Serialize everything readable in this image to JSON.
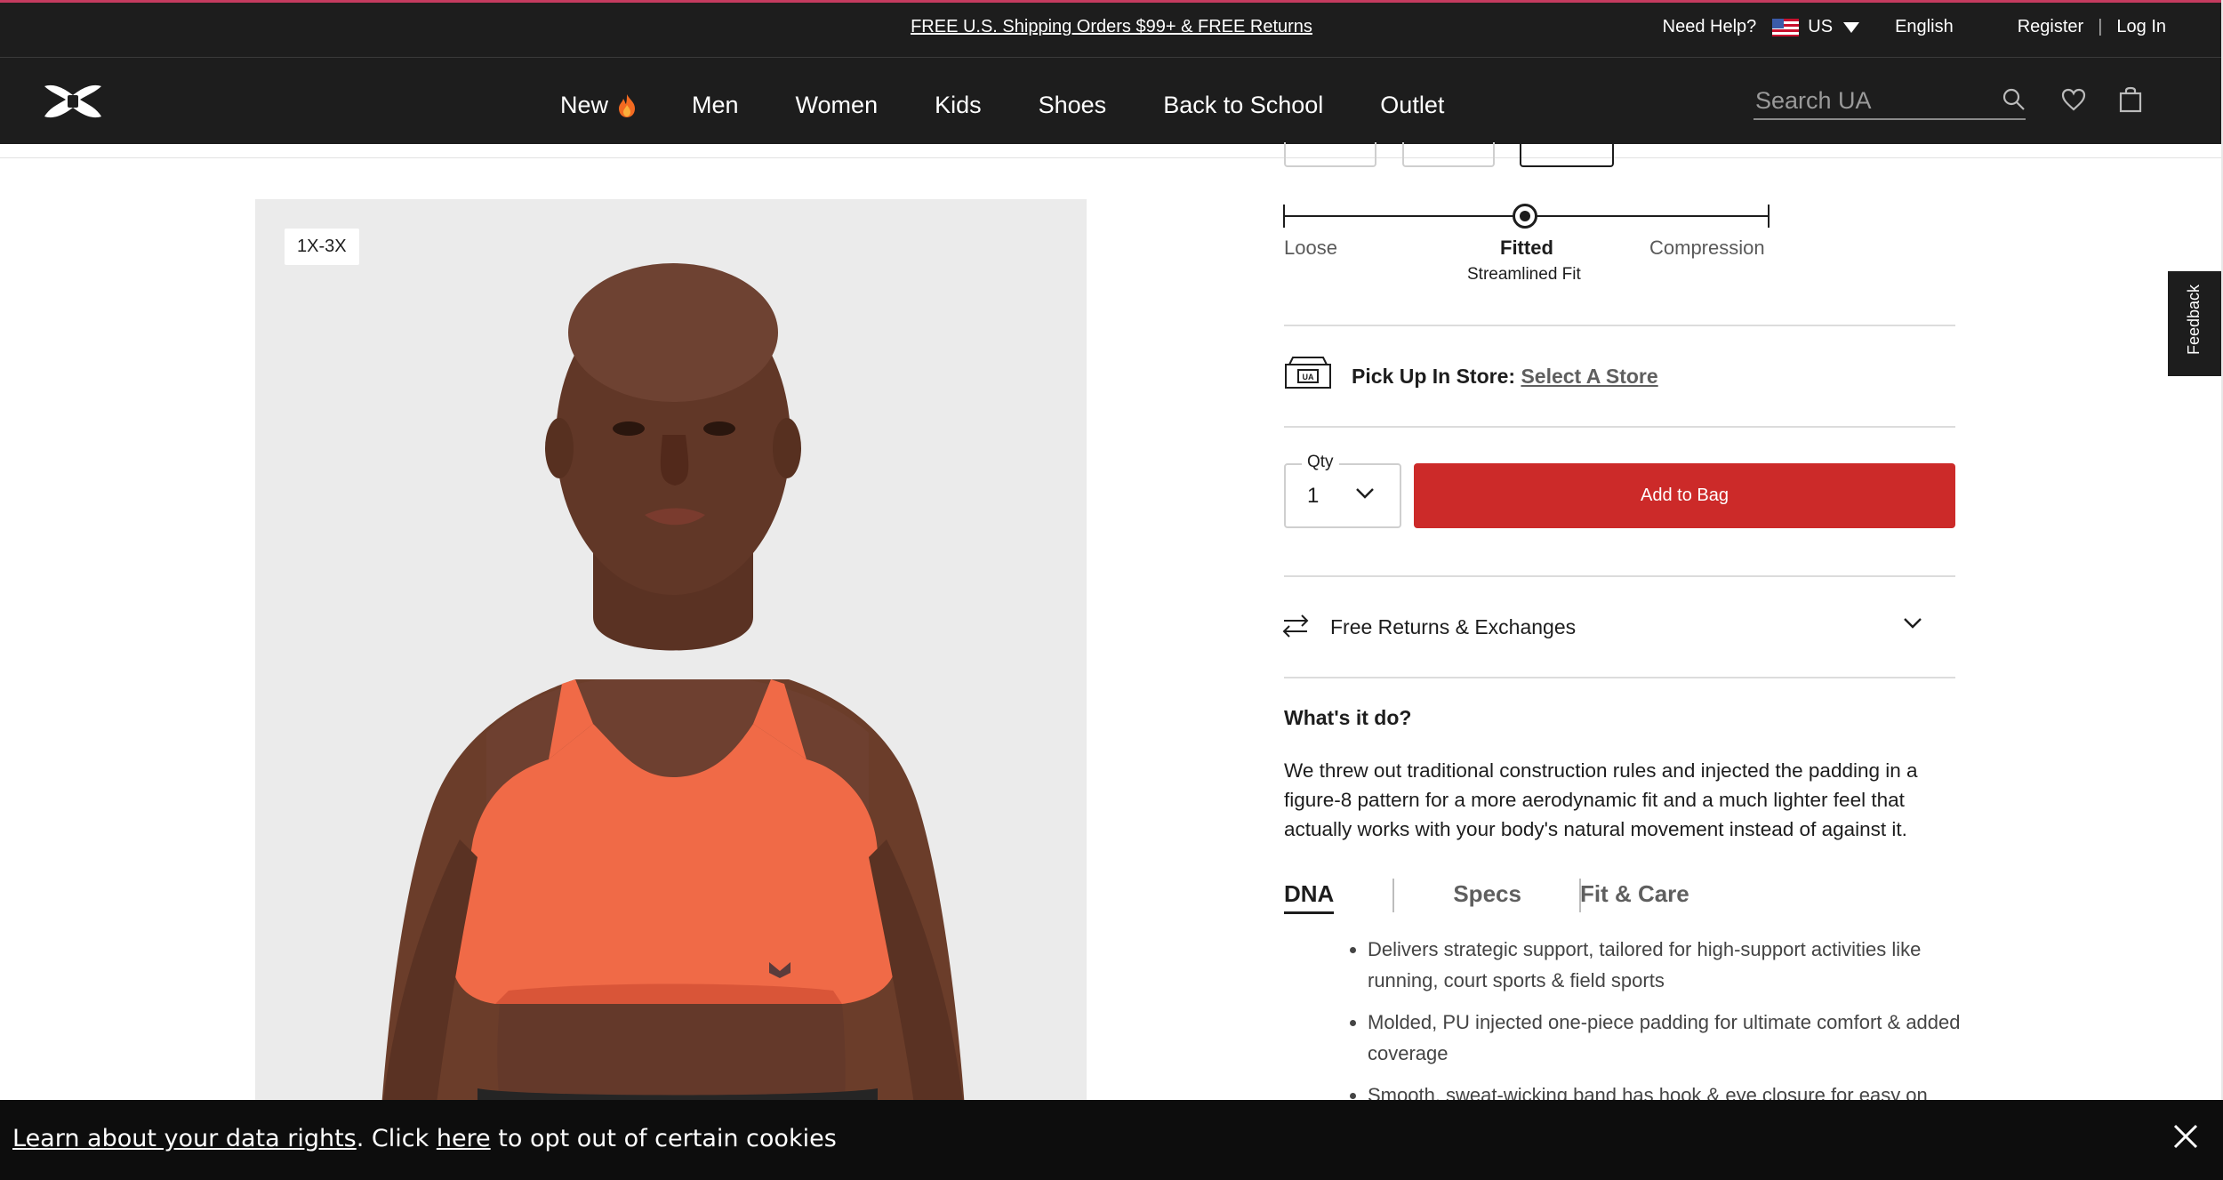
{
  "promo": {
    "center_text": "FREE U.S. Shipping Orders $99+ & FREE Returns",
    "need_help": "Need Help?",
    "country": "US",
    "language": "English",
    "register": "Register",
    "separator": "|",
    "login": "Log In"
  },
  "nav": {
    "items": [
      {
        "label": "New"
      },
      {
        "label": "Men"
      },
      {
        "label": "Women"
      },
      {
        "label": "Kids"
      },
      {
        "label": "Shoes"
      },
      {
        "label": "Back to School"
      },
      {
        "label": "Outlet"
      }
    ],
    "search_placeholder": "Search UA"
  },
  "product": {
    "size_badge": "1X-3X",
    "fit": {
      "left": "Loose",
      "center": "Fitted",
      "center_sub": "Streamlined Fit",
      "right": "Compression",
      "selected": "Fitted"
    },
    "store": {
      "label": "Pick Up In Store:",
      "link": "Select A Store"
    },
    "qty": {
      "label": "Qty",
      "value": "1"
    },
    "add_to_bag": "Add to Bag",
    "returns": "Free Returns & Exchanges",
    "whats_title": "What's it do?",
    "description": "We threw out traditional construction rules and injected the padding in a figure-8 pattern for a more aerodynamic fit and a much lighter feel that actually works with your body's natural movement instead of against it.",
    "tabs": [
      {
        "label": "DNA",
        "active": true
      },
      {
        "label": "Specs",
        "active": false
      },
      {
        "label": "Fit & Care",
        "active": false
      }
    ],
    "bullets": [
      "Delivers strategic support, tailored for high-support activities like running, court sports & field sports",
      "Molded, PU injected one-piece padding for ultimate comfort & added coverage",
      "Smooth, sweat-wicking band has hook & eye closure for easy on"
    ]
  },
  "feedback": "Feedback",
  "cookie": {
    "link1": "Learn about your data rights",
    "mid": ". Click ",
    "link2": "here",
    "end": " to opt out of certain cookies"
  },
  "colors": {
    "header_bg": "#1d1d1d",
    "accent_red": "#cc2a29",
    "bra_orange": "#f06a47"
  }
}
